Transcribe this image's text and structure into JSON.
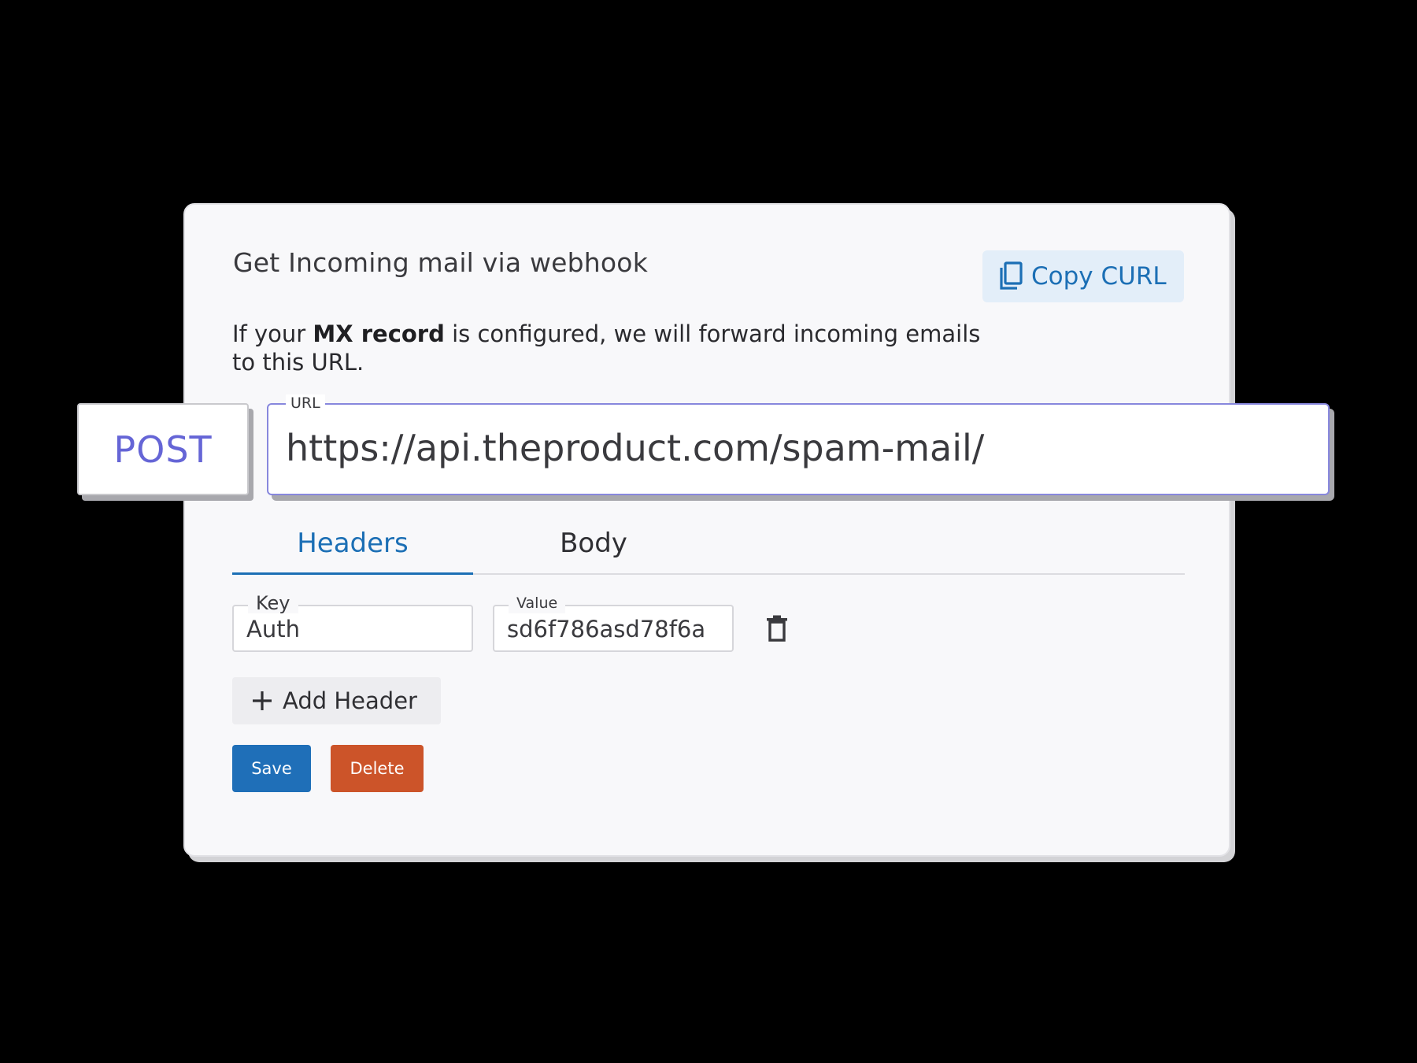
{
  "card": {
    "title": "Get Incoming mail via webhook",
    "copy_curl_label": "Copy CURL",
    "description": {
      "before": "If your ",
      "emphasis": "MX record",
      "after": " is configured, we will forward incoming emails to this URL."
    }
  },
  "request": {
    "method": "POST",
    "url_label": "URL",
    "url_value": "https://api.theproduct.com/spam-mail/"
  },
  "tabs": [
    {
      "label": "Headers",
      "active": true
    },
    {
      "label": "Body",
      "active": false
    }
  ],
  "header_row": {
    "key_label": "Key",
    "key_value": "Auth",
    "value_label": "Value",
    "value_value": "sd6f786asd78f6a"
  },
  "actions": {
    "add_header_label": "Add Header",
    "save_label": "Save",
    "delete_label": "Delete"
  },
  "icons": {
    "copy": "copy-icon",
    "trash": "trash-icon",
    "plus": "plus-icon"
  },
  "colors": {
    "primary": "#1f6fb8",
    "danger": "#cc5429",
    "method_accent": "#6565d6",
    "url_border": "#8787dd"
  }
}
